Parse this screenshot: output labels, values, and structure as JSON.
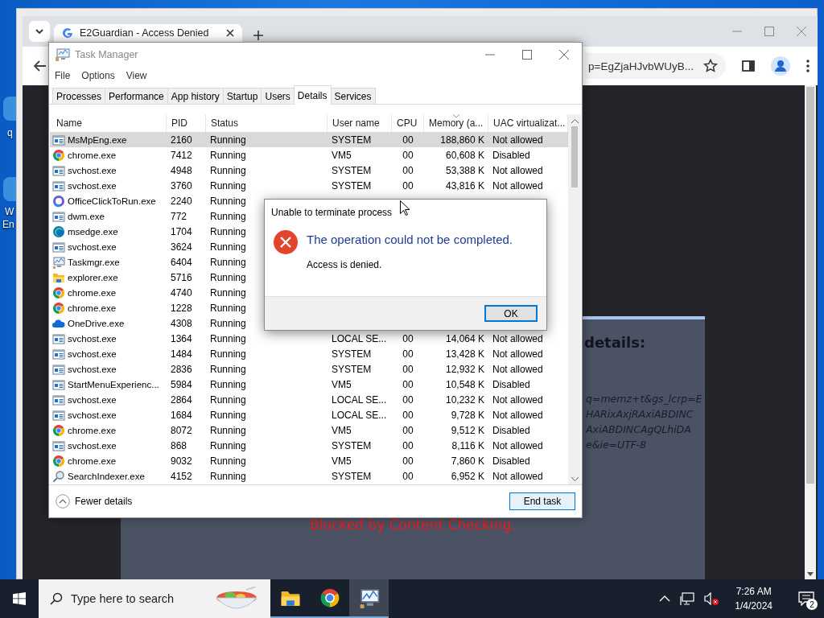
{
  "desktop": {
    "icon_labels": [
      "q",
      "W",
      "En"
    ]
  },
  "browser": {
    "tab_title": "E2Guardian - Access Denied",
    "address": "p=EgZjaHJvbWUyB...",
    "page": {
      "heading": "details:",
      "url_lines": [
        "q=memz+t&gs_lcrp=E",
        "HARixAxjRAxiABDINC",
        "AxiABDINCAgQLhiDA",
        "e&ie=UTF-8"
      ],
      "notice": "Blocked by Content Checking."
    }
  },
  "task_manager": {
    "title": "Task Manager",
    "menu": [
      "File",
      "Options",
      "View"
    ],
    "tabs": [
      {
        "label": "Processes",
        "selected": false
      },
      {
        "label": "Performance",
        "selected": false
      },
      {
        "label": "App history",
        "selected": false
      },
      {
        "label": "Startup",
        "selected": false
      },
      {
        "label": "Users",
        "selected": false
      },
      {
        "label": "Details",
        "selected": true
      },
      {
        "label": "Services",
        "selected": false
      }
    ],
    "columns": [
      {
        "label": "Name",
        "sorted": false
      },
      {
        "label": "PID",
        "sorted": false
      },
      {
        "label": "Status",
        "sorted": false
      },
      {
        "label": "User name",
        "sorted": false
      },
      {
        "label": "CPU",
        "sorted": false
      },
      {
        "label": "Memory (a...",
        "sorted": true
      },
      {
        "label": "UAC virtualizat...",
        "sorted": false
      }
    ],
    "rows": [
      {
        "kind": "app",
        "name": "MsMpEng.exe",
        "pid": "2160",
        "status": "Running",
        "user": "SYSTEM",
        "cpu": "00",
        "memory": "188,860 K",
        "uac": "Not allowed",
        "selected": true
      },
      {
        "kind": "chrome",
        "name": "chrome.exe",
        "pid": "7412",
        "status": "Running",
        "user": "VM5",
        "cpu": "00",
        "memory": "60,608 K",
        "uac": "Disabled",
        "selected": false
      },
      {
        "kind": "app",
        "name": "svchost.exe",
        "pid": "4948",
        "status": "Running",
        "user": "SYSTEM",
        "cpu": "00",
        "memory": "53,388 K",
        "uac": "Not allowed",
        "selected": false
      },
      {
        "kind": "app",
        "name": "svchost.exe",
        "pid": "3760",
        "status": "Running",
        "user": "SYSTEM",
        "cpu": "00",
        "memory": "43,816 K",
        "uac": "Not allowed",
        "selected": false
      },
      {
        "kind": "office",
        "name": "OfficeClickToRun.exe",
        "pid": "2240",
        "status": "Running",
        "selected": false
      },
      {
        "kind": "app",
        "name": "dwm.exe",
        "pid": "772",
        "status": "Running",
        "selected": false
      },
      {
        "kind": "edge",
        "name": "msedge.exe",
        "pid": "1704",
        "status": "Running",
        "selected": false
      },
      {
        "kind": "app",
        "name": "svchost.exe",
        "pid": "3624",
        "status": "Running",
        "selected": false
      },
      {
        "kind": "taskmgr",
        "name": "Taskmgr.exe",
        "pid": "6404",
        "status": "Running",
        "selected": false
      },
      {
        "kind": "explorer",
        "name": "explorer.exe",
        "pid": "5716",
        "status": "Running",
        "selected": false
      },
      {
        "kind": "chrome",
        "name": "chrome.exe",
        "pid": "4740",
        "status": "Running",
        "selected": false
      },
      {
        "kind": "chrome",
        "name": "chrome.exe",
        "pid": "1228",
        "status": "Running",
        "selected": false
      },
      {
        "kind": "onedrive",
        "name": "OneDrive.exe",
        "pid": "4308",
        "status": "Running",
        "selected": false
      },
      {
        "kind": "app",
        "name": "svchost.exe",
        "pid": "1364",
        "status": "Running",
        "user": "LOCAL SE...",
        "cpu": "00",
        "memory": "14,064 K",
        "uac": "Not allowed",
        "selected": false
      },
      {
        "kind": "app",
        "name": "svchost.exe",
        "pid": "1484",
        "status": "Running",
        "user": "SYSTEM",
        "cpu": "00",
        "memory": "13,428 K",
        "uac": "Not allowed",
        "selected": false
      },
      {
        "kind": "app",
        "name": "svchost.exe",
        "pid": "2836",
        "status": "Running",
        "user": "SYSTEM",
        "cpu": "00",
        "memory": "12,932 K",
        "uac": "Not allowed",
        "selected": false
      },
      {
        "kind": "app",
        "name": "StartMenuExperienc...",
        "pid": "5984",
        "status": "Running",
        "user": "VM5",
        "cpu": "00",
        "memory": "10,548 K",
        "uac": "Disabled",
        "selected": false
      },
      {
        "kind": "app",
        "name": "svchost.exe",
        "pid": "2864",
        "status": "Running",
        "user": "LOCAL SE...",
        "cpu": "00",
        "memory": "10,232 K",
        "uac": "Not allowed",
        "selected": false
      },
      {
        "kind": "app",
        "name": "svchost.exe",
        "pid": "1684",
        "status": "Running",
        "user": "LOCAL SE...",
        "cpu": "00",
        "memory": "9,728 K",
        "uac": "Not allowed",
        "selected": false
      },
      {
        "kind": "chrome",
        "name": "chrome.exe",
        "pid": "8072",
        "status": "Running",
        "user": "VM5",
        "cpu": "00",
        "memory": "9,512 K",
        "uac": "Disabled",
        "selected": false
      },
      {
        "kind": "app",
        "name": "svchost.exe",
        "pid": "868",
        "status": "Running",
        "user": "SYSTEM",
        "cpu": "00",
        "memory": "8,116 K",
        "uac": "Not allowed",
        "selected": false
      },
      {
        "kind": "chrome",
        "name": "chrome.exe",
        "pid": "9032",
        "status": "Running",
        "user": "VM5",
        "cpu": "00",
        "memory": "7,860 K",
        "uac": "Disabled",
        "selected": false
      },
      {
        "kind": "search",
        "name": "SearchIndexer.exe",
        "pid": "4152",
        "status": "Running",
        "user": "SYSTEM",
        "cpu": "00",
        "memory": "6,952 K",
        "uac": "Not allowed",
        "selected": false
      }
    ],
    "footer": {
      "toggle": "Fewer details",
      "button": "End task"
    }
  },
  "dialog": {
    "title": "Unable to terminate process",
    "heading": "The operation could not be completed.",
    "message": "Access is denied.",
    "button": "OK"
  },
  "taskbar": {
    "search_placeholder": "Type here to search",
    "apps": [
      {
        "kind": "explorer",
        "selected": false
      },
      {
        "kind": "chrome",
        "selected": false
      },
      {
        "kind": "taskmgr",
        "selected": true
      }
    ],
    "time": "7:26 AM",
    "date": "1/4/2024",
    "notifications": "2"
  }
}
